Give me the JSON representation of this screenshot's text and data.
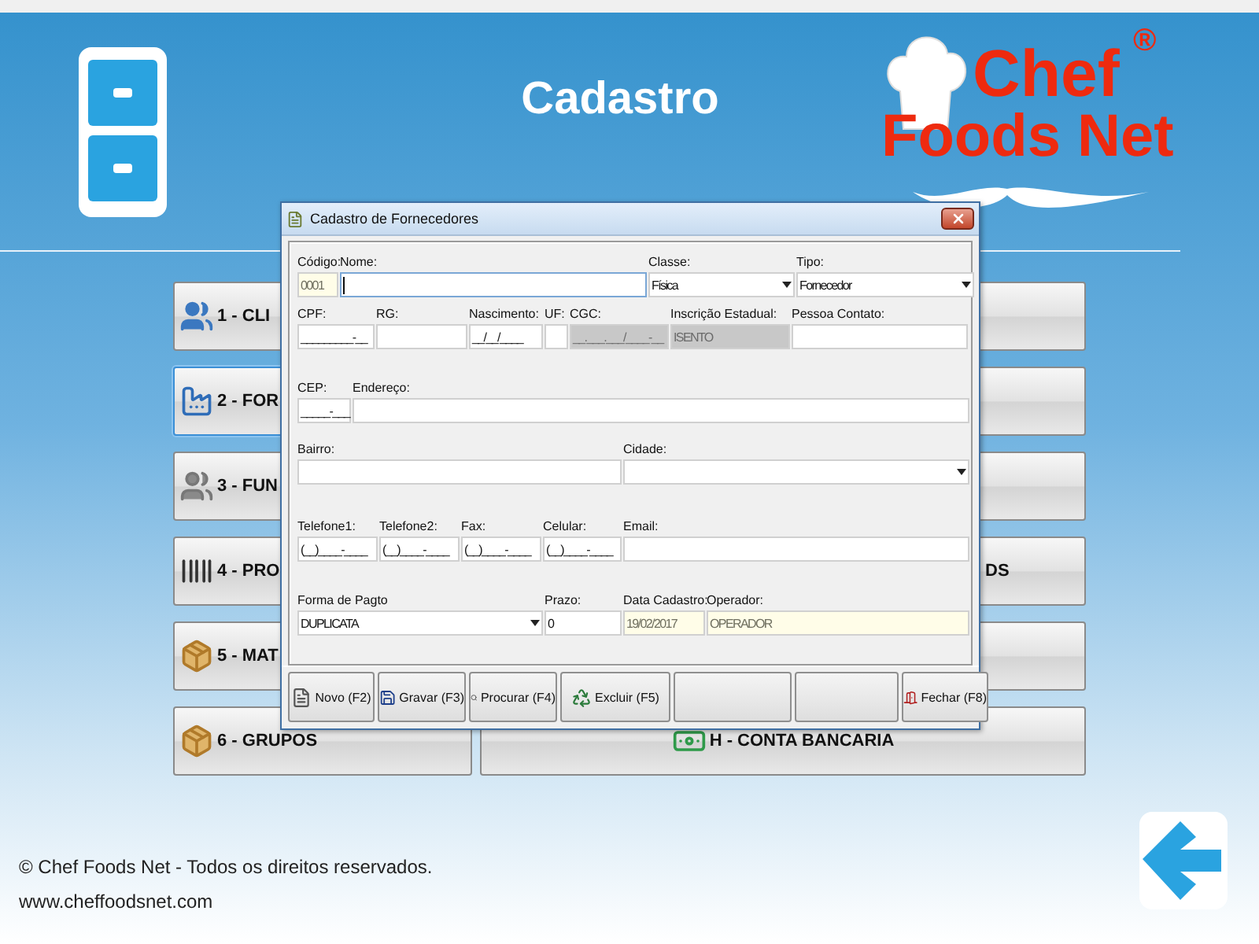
{
  "header": {
    "title": "Cadastro",
    "logo": {
      "line_1": "Chef",
      "line_2": "Foods Net",
      "mark": "®"
    }
  },
  "menu": {
    "left": [
      {
        "label": "1 - CLI",
        "selected": false
      },
      {
        "label": "2 - FOR",
        "selected": true
      },
      {
        "label": "3 - FUN",
        "selected": false
      },
      {
        "label": "4 - PRO",
        "selected": false
      },
      {
        "label": "5 - MAT",
        "selected": false
      },
      {
        "label": "6 - GRUPOS",
        "selected": false
      }
    ],
    "right": [
      {
        "selected": false
      },
      {
        "selected": false
      },
      {
        "selected": false
      },
      {
        "label": "DS",
        "selected": false
      },
      {
        "selected": false
      },
      {
        "label": "H - CONTA BANCARIA",
        "selected": false
      }
    ]
  },
  "dialog": {
    "title": "Cadastro de Fornecedores",
    "form_lines": [
      {
        "fields": [
          {
            "label": "Código:",
            "value": "0001",
            "kind": "readonly"
          },
          {
            "label": "Nome:",
            "kind": "active"
          },
          {
            "label": "Classe:",
            "value": "Física",
            "kind": "select"
          },
          {
            "label": "Tipo:",
            "value": "Fornecedor",
            "kind": "select"
          }
        ]
      },
      {
        "fields": [
          {
            "label": "CPF:",
            "value": "_________-__",
            "kind": "input"
          },
          {
            "label": "RG:",
            "kind": "input"
          },
          {
            "label": "Nascimento:",
            "value": "__/__/____",
            "kind": "input"
          },
          {
            "label": "UF:",
            "kind": "input"
          },
          {
            "label": "CGC:",
            "value": "__.___.___/____-__",
            "kind": "locked"
          },
          {
            "label": "Inscrição Estadual:",
            "value": "ISENTO",
            "kind": "locked"
          },
          {
            "label": "Pessoa Contato:",
            "kind": "input"
          }
        ]
      },
      {
        "fields": [
          {
            "label": "CEP:",
            "value": "_____-___",
            "kind": "input"
          },
          {
            "label": "Endereço:",
            "kind": "input"
          }
        ]
      },
      {
        "fields": [
          {
            "label": "Bairro:",
            "kind": "input"
          },
          {
            "label": "Cidade:",
            "kind": "select"
          }
        ]
      },
      {
        "fields": [
          {
            "label": "Telefone1:",
            "value": "(__)____-____",
            "kind": "input"
          },
          {
            "label": "Telefone2:",
            "value": "(__)____-____",
            "kind": "input"
          },
          {
            "label": "Fax:",
            "value": "(__)____-____",
            "kind": "input"
          },
          {
            "label": "Celular:",
            "value": "(__)____-____",
            "kind": "input"
          },
          {
            "label": "Email:",
            "kind": "input"
          }
        ]
      },
      {
        "fields": [
          {
            "label": "Forma de Pagto",
            "value": "DUPLICATA",
            "kind": "select"
          },
          {
            "label": "Prazo:",
            "value": "0",
            "kind": "input"
          },
          {
            "label": "Data Cadastro:",
            "value": "19/02/2017",
            "kind": "readonly"
          },
          {
            "label": "Operador:",
            "value": "OPERADOR",
            "kind": "readonly"
          }
        ]
      }
    ],
    "buttons": [
      {
        "label": "Novo (F2)",
        "kind": "action"
      },
      {
        "label": "Gravar (F3)",
        "kind": "action"
      },
      {
        "label": "Procurar (F4)",
        "kind": "action"
      },
      {
        "label": "Excluir (F5)",
        "kind": "action"
      },
      {
        "kind": "blank"
      },
      {
        "kind": "blank"
      },
      {
        "label": "Fechar (F8)",
        "kind": "action"
      }
    ]
  },
  "footer": {
    "copyright": "© Chef Foods Net - Todos os direitos reservados.",
    "website": "www.cheffoodsnet.com"
  }
}
